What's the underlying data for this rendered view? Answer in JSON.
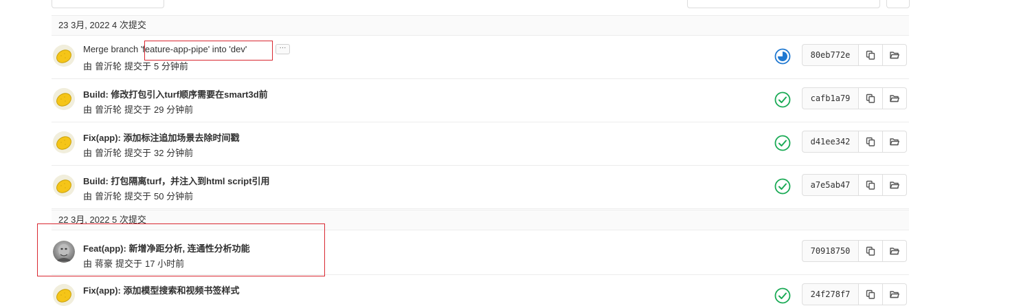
{
  "days": [
    {
      "header": "23 3月, 2022 4 次提交",
      "commits": [
        {
          "title_prefix": "Merge branch ",
          "title_highlight": "'feature-app-pipe' into 'dev'",
          "by": "由",
          "author": "曾沂轮",
          "committed": "提交于",
          "time": "5 分钟前",
          "status": "running",
          "sha": "80eb772e",
          "avatar": "lemon-avatar",
          "ellipsis": "···"
        },
        {
          "title": "Build: 修改打包引入turf顺序需要在smart3d前",
          "by": "由",
          "author": "曾沂轮",
          "committed": "提交于",
          "time": "29 分钟前",
          "status": "passed",
          "sha": "cafb1a79",
          "avatar": "lemon-avatar"
        },
        {
          "title": "Fix(app): 添加标注追加场景去除时间戳",
          "by": "由",
          "author": "曾沂轮",
          "committed": "提交于",
          "time": "32 分钟前",
          "status": "passed",
          "sha": "d41ee342",
          "avatar": "lemon-avatar"
        },
        {
          "title": "Build: 打包隔离turf，并注入到html script引用",
          "by": "由",
          "author": "曾沂轮",
          "committed": "提交于",
          "time": "50 分钟前",
          "status": "passed",
          "sha": "a7e5ab47",
          "avatar": "lemon-avatar"
        }
      ]
    },
    {
      "header": "22 3月, 2022 5 次提交",
      "commits": [
        {
          "title": "Feat(app): 新增净距分析, 连通性分析功能",
          "by": "由",
          "author": "蒋豪",
          "committed": "提交于",
          "time": "17 小时前",
          "status": "none",
          "sha": "70918750",
          "avatar": "photo-avatar"
        },
        {
          "title": "Fix(app): 添加模型搜索和视频书签样式",
          "status": "passed",
          "sha": "24f278f7",
          "avatar": "lemon-avatar"
        }
      ]
    }
  ],
  "colors": {
    "passed": "#1aaa55",
    "running": "#1f78d1",
    "highlight_box": "#d9262f"
  },
  "icons": {
    "copy": "copy-icon",
    "browse": "folder-open-icon"
  }
}
